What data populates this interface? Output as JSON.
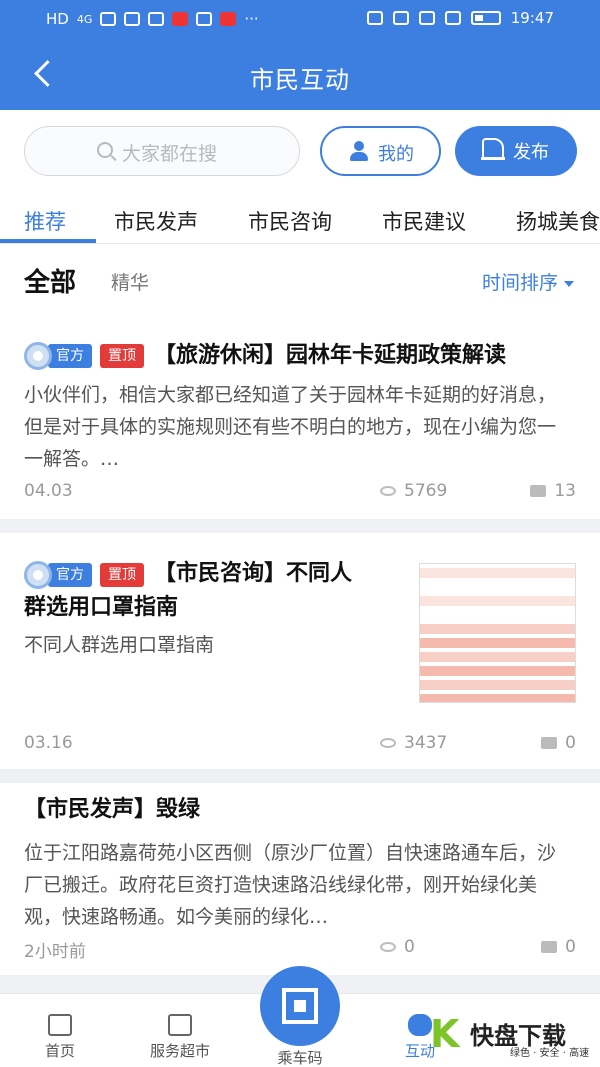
{
  "status_bar": {
    "left_text": "HD",
    "network": "4G",
    "time": "19:47"
  },
  "header": {
    "title": "市民互动"
  },
  "search": {
    "placeholder": "大家都在搜"
  },
  "actions": {
    "mine_label": "我的",
    "post_label": "发布"
  },
  "tabs": [
    {
      "label": "推荐",
      "active": true
    },
    {
      "label": "市民发声",
      "active": false
    },
    {
      "label": "市民咨询",
      "active": false
    },
    {
      "label": "市民建议",
      "active": false
    },
    {
      "label": "扬城美食",
      "active": false
    }
  ],
  "filter": {
    "all_label": "全部",
    "best_label": "精华",
    "sort_label": "时间排序"
  },
  "posts": [
    {
      "official_tag": "官方",
      "top_tag": "置顶",
      "title": "【旅游休闲】园林年卡延期政策解读",
      "body": "小伙伴们，相信大家都已经知道了关于园林年卡延期的好消息，但是对于具体的实施规则还有些不明白的地方，现在小编为您一一解答。…",
      "date": "04.03",
      "views": "5769",
      "comments": "13"
    },
    {
      "official_tag": "官方",
      "top_tag": "置顶",
      "title_line1": "【市民咨询】不同人",
      "title_line2": "群选用口罩指南",
      "body": "不同人群选用口罩指南",
      "date": "03.16",
      "views": "3437",
      "comments": "0"
    },
    {
      "title": "【市民发声】毁绿",
      "body": "位于江阳路嘉荷苑小区西侧（原沙厂位置）自快速路通车后，沙厂已搬迁。政府花巨资打造快速路沿线绿化带，刚开始绿化美观，快速路畅通。如今美丽的绿化…",
      "date": "2小时前",
      "views": "0",
      "comments": "0"
    }
  ],
  "bottom_nav": {
    "home": "首页",
    "market": "服务超市",
    "ride_code": "乘车码",
    "interact": "互动"
  },
  "watermark": {
    "main": "快盘下载",
    "sub": "绿色 · 安全 · 高速"
  },
  "colors": {
    "brand_blue": "#3d7fe0",
    "tag_red": "#e33a3a"
  }
}
